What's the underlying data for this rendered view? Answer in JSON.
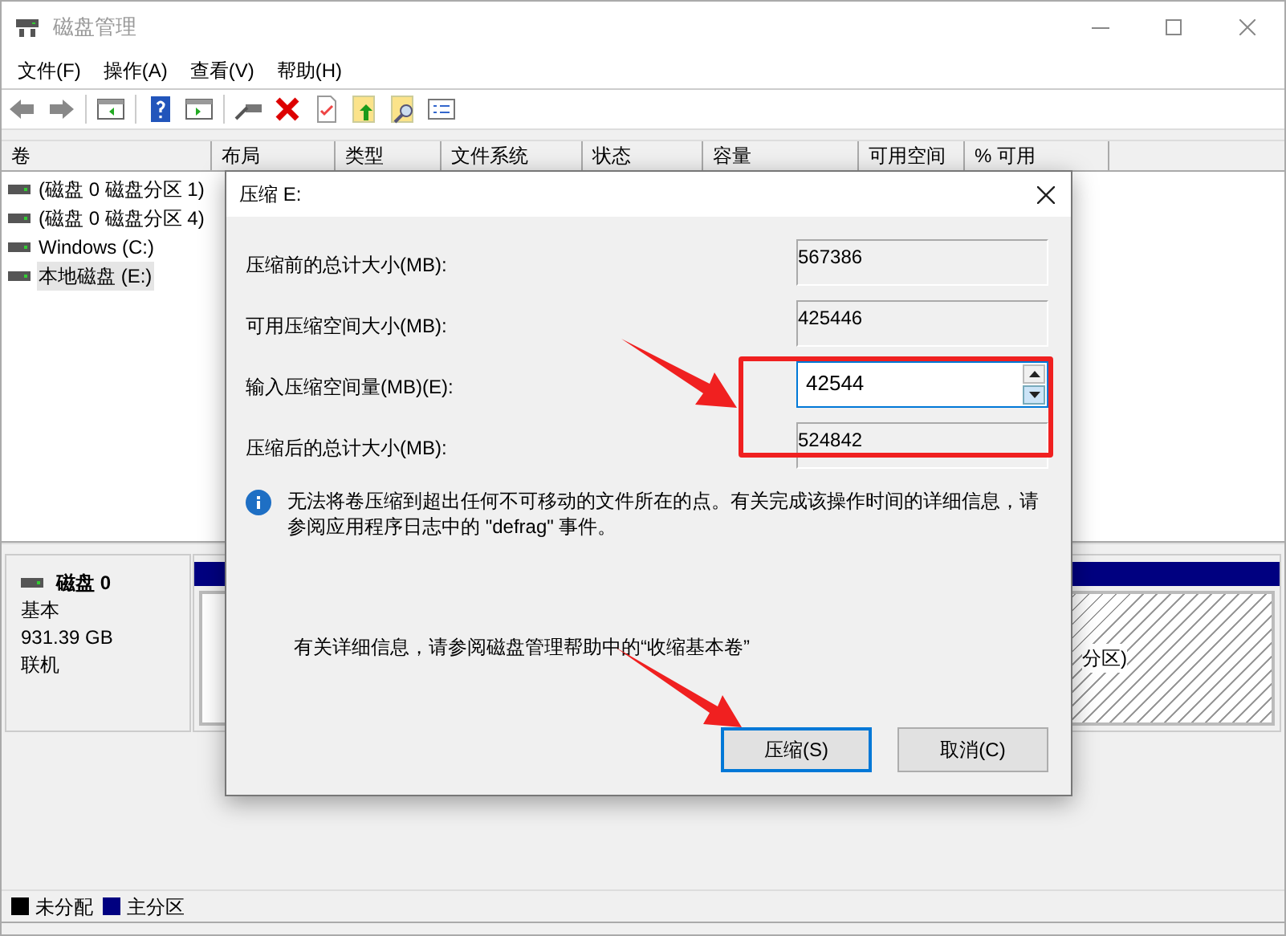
{
  "window": {
    "title": "磁盘管理"
  },
  "menu": [
    {
      "label": "文件(F)"
    },
    {
      "label": "操作(A)"
    },
    {
      "label": "查看(V)"
    },
    {
      "label": "帮助(H)"
    }
  ],
  "table": {
    "columns": [
      "卷",
      "布局",
      "类型",
      "文件系统",
      "状态",
      "容量",
      "可用空间",
      "% 可用"
    ],
    "rows": [
      {
        "volume": "(磁盘 0 磁盘分区 1)",
        "selected": false
      },
      {
        "volume": "(磁盘 0 磁盘分区 4)",
        "selected": false
      },
      {
        "volume": "Windows (C:)",
        "selected": false
      },
      {
        "volume": "本地磁盘 (E:)",
        "selected": true
      }
    ]
  },
  "disk": {
    "name": "磁盘 0",
    "type": "基本",
    "size": "931.39 GB",
    "status": "联机",
    "partition_right": {
      "text": "分区)"
    }
  },
  "legend": [
    {
      "label": "未分配",
      "color": "#000000"
    },
    {
      "label": "主分区",
      "color": "#000080"
    }
  ],
  "dialog": {
    "title": "压缩 E:",
    "fields": [
      {
        "label": "压缩前的总计大小(MB):",
        "value": "567386",
        "kind": "readonly"
      },
      {
        "label": "可用压缩空间大小(MB):",
        "value": "425446",
        "kind": "readonly"
      },
      {
        "label": "输入压缩空间量(MB)(E):",
        "value": "42544",
        "kind": "spin"
      },
      {
        "label": "压缩后的总计大小(MB):",
        "value": "524842",
        "kind": "readonly"
      }
    ],
    "info": "无法将卷压缩到超出任何不可移动的文件所在的点。有关完成该操作时间的详细信息，请参阅应用程序日志中的 \"defrag\" 事件。",
    "help": "有关详细信息，请参阅磁盘管理帮助中的“收缩基本卷”",
    "buttons": [
      {
        "label": "压缩(S)",
        "default": true
      },
      {
        "label": "取消(C)",
        "default": false
      }
    ]
  }
}
